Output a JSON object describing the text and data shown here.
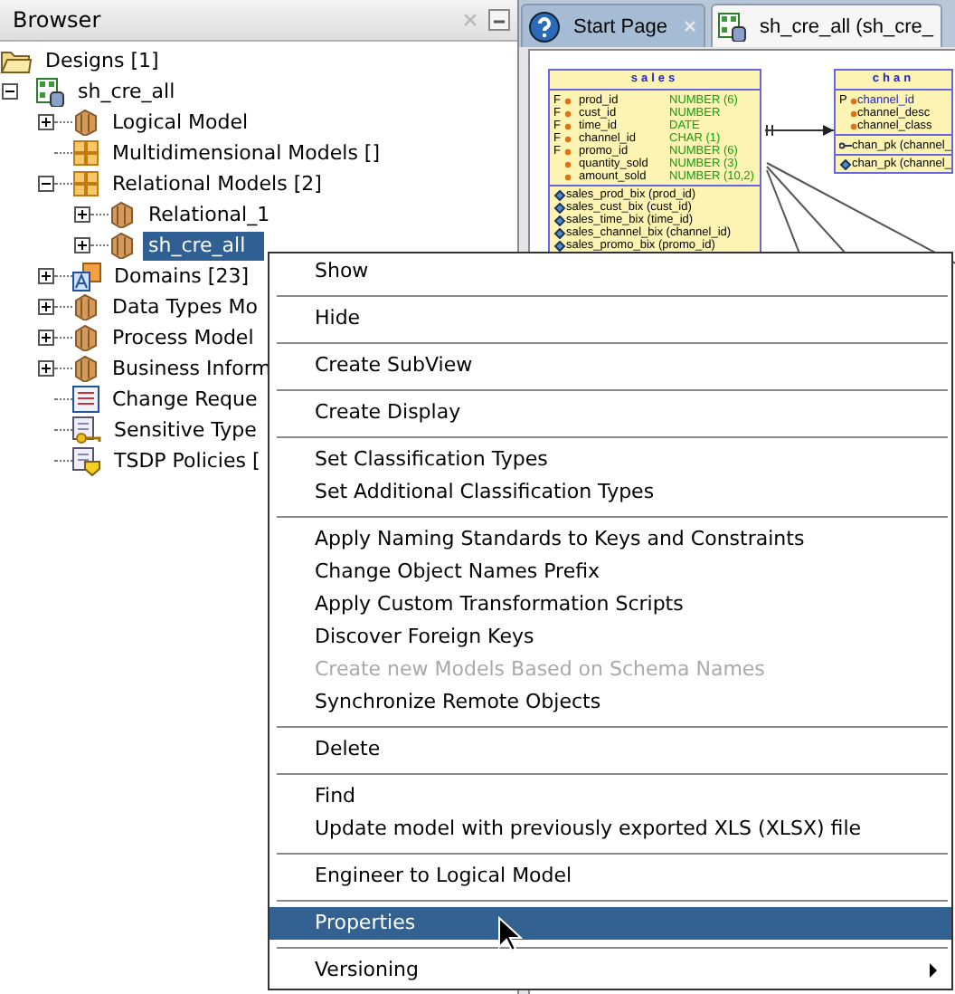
{
  "browser": {
    "title": "Browser",
    "tree": [
      {
        "label": "Designs [1]",
        "kind": "folder",
        "selected": false
      },
      {
        "label": "sh_cre_all",
        "kind": "design",
        "selected": false,
        "expanded": true,
        "children": [
          {
            "label": "Logical Model",
            "kind": "cube",
            "selected": false,
            "expanded": false
          },
          {
            "label": "Multidimensional Models []",
            "kind": "grid",
            "selected": false
          },
          {
            "label": "Relational Models [2]",
            "kind": "grid",
            "selected": false,
            "expanded": true,
            "children": [
              {
                "label": "Relational_1",
                "kind": "cube",
                "selected": false,
                "expanded": false
              },
              {
                "label": "sh_cre_all",
                "kind": "cube",
                "selected": true,
                "expanded": false
              }
            ]
          },
          {
            "label": "Domains [23]",
            "kind": "domain",
            "selected": false,
            "expanded": false
          },
          {
            "label": "Data Types Mo",
            "kind": "cube",
            "selected": false,
            "expanded": false
          },
          {
            "label": "Process Model",
            "kind": "cube",
            "selected": false,
            "expanded": false
          },
          {
            "label": "Business Inform",
            "kind": "cube",
            "selected": false,
            "expanded": false
          },
          {
            "label": "Change Reque",
            "kind": "list",
            "selected": false
          },
          {
            "label": "Sensitive Type",
            "kind": "sensitive",
            "selected": false
          },
          {
            "label": "TSDP Policies [",
            "kind": "policy",
            "selected": false
          }
        ]
      }
    ]
  },
  "tabs": [
    {
      "label": "Start Page",
      "kind": "help",
      "selected": false
    },
    {
      "label": "sh_cre_all (sh_cre_",
      "kind": "design",
      "selected": true
    }
  ],
  "diagram": {
    "tables": [
      {
        "title": "sales",
        "columns": [
          {
            "flag": "F",
            "name": "prod_id",
            "type": "NUMBER (6)"
          },
          {
            "flag": "F",
            "name": "cust_id",
            "type": "NUMBER"
          },
          {
            "flag": "F",
            "name": "time_id",
            "type": "DATE"
          },
          {
            "flag": "F",
            "name": "channel_id",
            "type": "CHAR (1)"
          },
          {
            "flag": "F",
            "name": "promo_id",
            "type": "NUMBER (6)"
          },
          {
            "name": "quantity_sold",
            "type": "NUMBER (3)"
          },
          {
            "name": "amount_sold",
            "type": "NUMBER (10,2)"
          }
        ],
        "indexes": [
          "sales_prod_bix (prod_id)",
          "sales_cust_bix (cust_id)",
          "sales_time_bix (time_id)",
          "sales_channel_bix (channel_id)",
          "sales_promo_bix (promo_id)"
        ]
      },
      {
        "title": "chan",
        "columns": [
          {
            "flag": "P",
            "name": "channel_id"
          },
          {
            "name": "channel_desc"
          },
          {
            "name": "channel_class"
          }
        ],
        "keys": [
          "chan_pk (channel_"
        ],
        "indexes": [
          "chan_pk (channel_"
        ]
      }
    ]
  },
  "context_menu": {
    "groups": [
      [
        {
          "label": "Show",
          "disabled": false,
          "selected": false
        }
      ],
      [
        {
          "label": "Hide",
          "disabled": false,
          "selected": false
        }
      ],
      [
        {
          "label": "Create SubView",
          "disabled": false,
          "selected": false
        }
      ],
      [
        {
          "label": "Create Display",
          "disabled": false,
          "selected": false
        }
      ],
      [
        {
          "label": "Set Classification Types",
          "disabled": false,
          "selected": false
        },
        {
          "label": "Set Additional Classification Types",
          "disabled": false,
          "selected": false
        }
      ],
      [
        {
          "label": "Apply Naming Standards to Keys and Constraints",
          "disabled": false,
          "selected": false
        },
        {
          "label": "Change Object Names Prefix",
          "disabled": false,
          "selected": false
        },
        {
          "label": "Apply Custom Transformation Scripts",
          "disabled": false,
          "selected": false
        },
        {
          "label": "Discover Foreign Keys",
          "disabled": false,
          "selected": false
        },
        {
          "label": "Create new Models Based on Schema Names",
          "disabled": true,
          "selected": false
        },
        {
          "label": "Synchronize Remote Objects",
          "disabled": false,
          "selected": false
        }
      ],
      [
        {
          "label": "Delete",
          "disabled": false,
          "selected": false
        }
      ],
      [
        {
          "label": "Find",
          "disabled": false,
          "selected": false
        },
        {
          "label": "Update model with previously exported XLS (XLSX) file",
          "disabled": false,
          "selected": false
        }
      ],
      [
        {
          "label": "Engineer to Logical Model",
          "disabled": false,
          "selected": false
        }
      ],
      [
        {
          "label": "Properties",
          "disabled": false,
          "selected": true
        }
      ],
      [
        {
          "label": "Versioning",
          "disabled": false,
          "selected": false,
          "submenu": true
        }
      ]
    ]
  }
}
